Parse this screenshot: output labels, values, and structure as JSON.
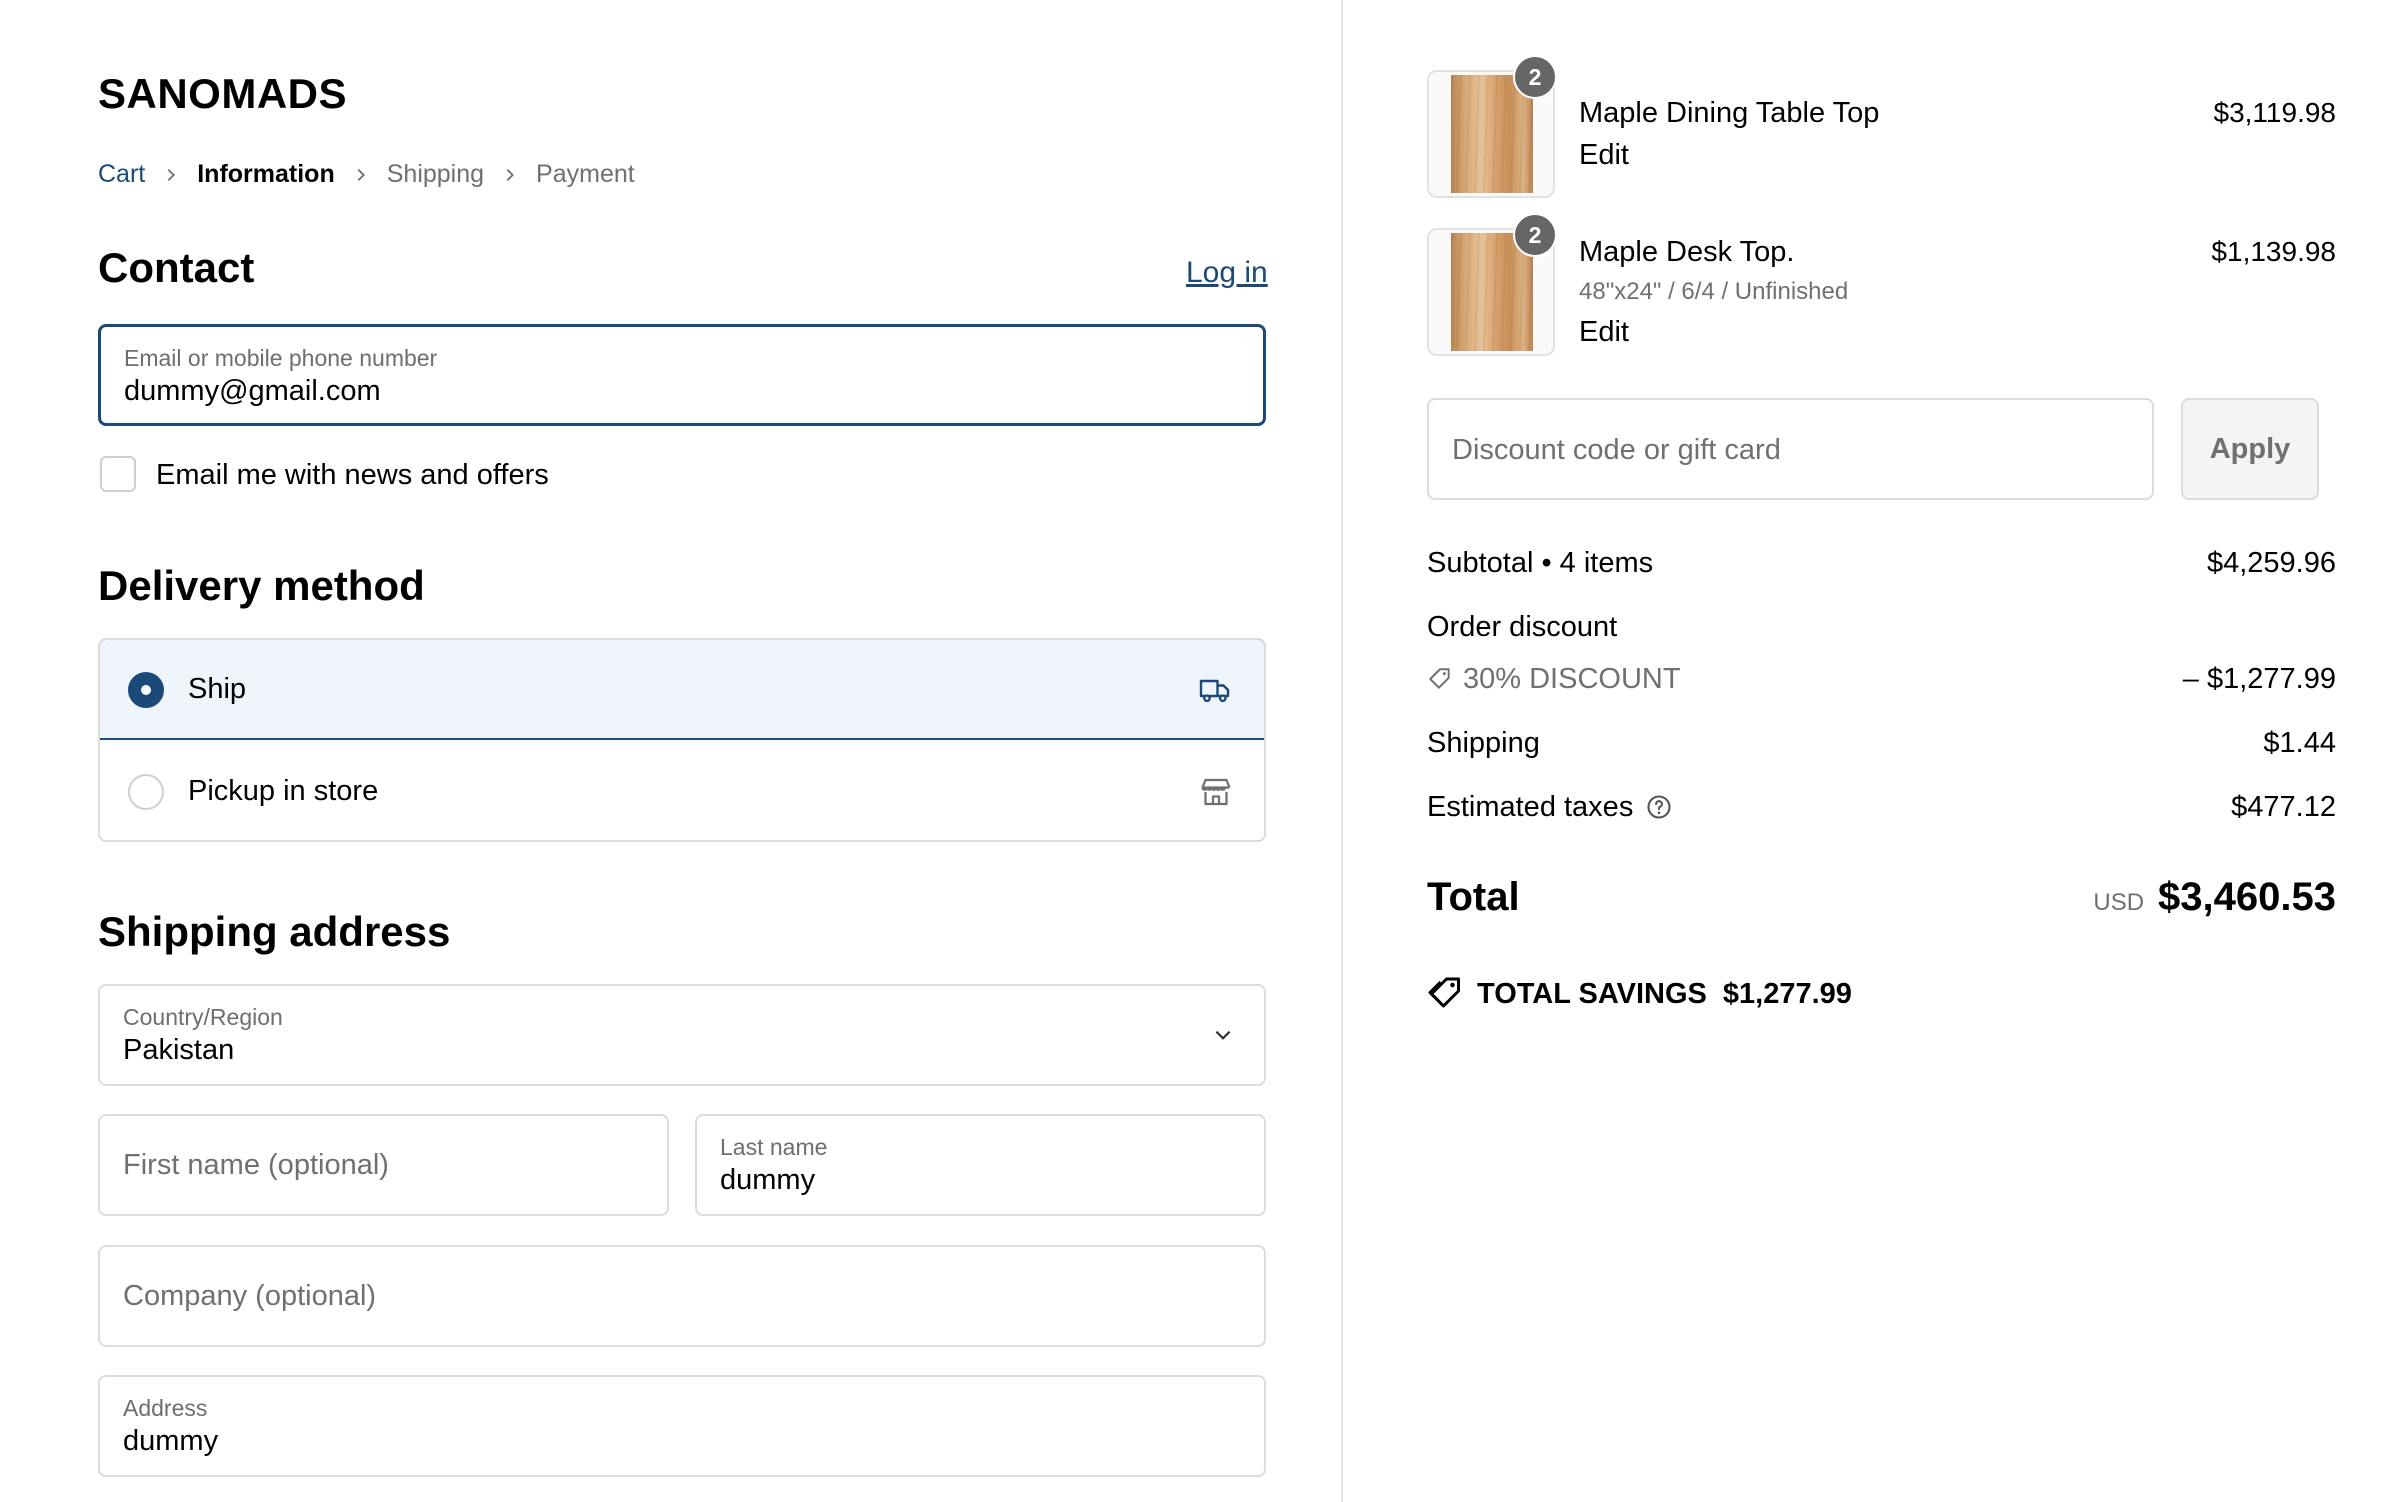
{
  "brand": "SANOMADS",
  "breadcrumb": {
    "cart": "Cart",
    "information": "Information",
    "shipping": "Shipping",
    "payment": "Payment"
  },
  "contact": {
    "title": "Contact",
    "login": "Log in",
    "email_label": "Email or mobile phone number",
    "email_value": "dummy@gmail.com",
    "news_label": "Email me with news and offers"
  },
  "delivery": {
    "title": "Delivery method",
    "ship": "Ship",
    "pickup": "Pickup in store"
  },
  "shipping_address": {
    "title": "Shipping address",
    "country_label": "Country/Region",
    "country_value": "Pakistan",
    "first_name_placeholder": "First name (optional)",
    "last_name_label": "Last name",
    "last_name_value": "dummy",
    "company_placeholder": "Company (optional)",
    "address_label": "Address",
    "address_value": "dummy"
  },
  "cart": {
    "items": [
      {
        "qty": "2",
        "name": "Maple Dining Table Top",
        "variant": "",
        "edit": "Edit",
        "price": "$3,119.98"
      },
      {
        "qty": "2",
        "name": "Maple Desk Top.",
        "variant": "48\"x24\" / 6/4 / Unfinished",
        "edit": "Edit",
        "price": "$1,139.98"
      }
    ],
    "discount_placeholder": "Discount code or gift card",
    "apply": "Apply",
    "subtotal_label": "Subtotal • 4 items",
    "subtotal": "$4,259.96",
    "order_discount_label": "Order discount",
    "discount_code": "30% DISCOUNT",
    "discount_amount": "– $1,277.99",
    "shipping_label": "Shipping",
    "shipping": "$1.44",
    "taxes_label": "Estimated taxes",
    "taxes": "$477.12",
    "total_label": "Total",
    "currency": "USD",
    "total": "$3,460.53",
    "savings_label": "TOTAL SAVINGS",
    "savings": "$1,277.99"
  },
  "colors": {
    "accent": "#1b4a79",
    "muted": "#707070",
    "border": "#dcdcdc",
    "selected_bg": "#f0f5fb"
  }
}
